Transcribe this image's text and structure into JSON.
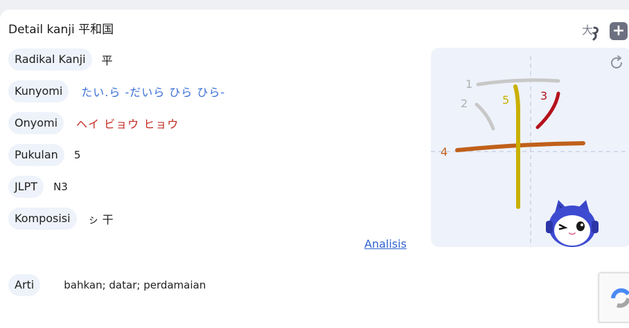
{
  "detail": {
    "title": "Detail kanji 平和国"
  },
  "rows": [
    {
      "label": "Radikal Kanji",
      "value": "平"
    },
    {
      "label": "Kunyomi",
      "value": "たい.ら  -だいら  ひら  ひら-"
    },
    {
      "label": "Onyomi",
      "value": "ヘイ  ビョウ  ヒョウ"
    },
    {
      "label": "Pukulan",
      "value": "5"
    },
    {
      "label": "JLPT",
      "value": "N3"
    },
    {
      "label": "Komposisi",
      "value": "ㇱ 干"
    }
  ],
  "analisis_link": "Analisis",
  "arti": {
    "label": "Arti",
    "value": "bahkan; datar; perdamaian"
  },
  "stroke_order": {
    "numbers": [
      "1",
      "2",
      "3",
      "4",
      "5"
    ],
    "colors": {
      "stroke1": "#c8c8c8",
      "stroke2": "#c8c8c8",
      "stroke3": "#b5121b",
      "stroke4": "#c0601a",
      "stroke5": "#c9b000"
    }
  },
  "icons": {
    "voice": "voice-icon",
    "add": "add-icon",
    "refresh": "refresh-icon"
  },
  "add_symbol": "+",
  "voice_glyph": "大"
}
